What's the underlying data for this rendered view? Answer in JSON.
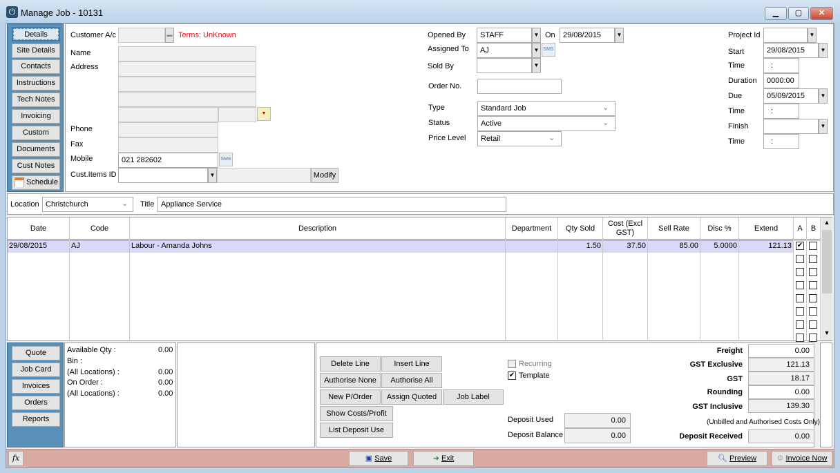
{
  "window": {
    "title": "Manage Job - 10131",
    "app_icon": "power-icon",
    "minimize": "▁",
    "maximize": "▢",
    "close": "✕"
  },
  "nav": {
    "items": [
      "Details",
      "Site Details",
      "Contacts",
      "Instructions",
      "Tech Notes",
      "Invoicing",
      "Custom Fields",
      "Documents",
      "Cust Notes",
      "Schedule"
    ]
  },
  "customer": {
    "account_label": "Customer A/c",
    "account_value": "",
    "terms": "Terms: UnKnown",
    "terms_color": "#e8101a",
    "name_label": "Name",
    "address_label": "Address",
    "phone_label": "Phone",
    "fax_label": "Fax",
    "mobile_label": "Mobile",
    "mobile_value": "021 282602",
    "cust_items_label": "Cust.Items ID",
    "cust_items_value": "",
    "modify": "Modify",
    "sms": "SMS"
  },
  "job": {
    "opened_by_label": "Opened By",
    "opened_by": "STAFF",
    "on_label": "On",
    "on_date": "29/08/2015",
    "assigned_to_label": "Assigned To",
    "assigned_to": "AJ",
    "sold_by_label": "Sold By",
    "sold_by": "",
    "order_no_label": "Order No.",
    "order_no": "",
    "type_label": "Type",
    "type": "Standard Job",
    "status_label": "Status",
    "status": "Active",
    "price_level_label": "Price Level",
    "price_level": "Retail"
  },
  "schedule": {
    "project_id_label": "Project Id",
    "project_id": "",
    "start_label": "Start",
    "start": "29/08/2015",
    "time_label": "Time",
    "start_time": ":",
    "duration_label": "Duration",
    "duration": "0000:00",
    "due_label": "Due",
    "due": "05/09/2015",
    "due_time": ":",
    "finish_label": "Finish",
    "finish": "",
    "finish_time": ":"
  },
  "location": {
    "label": "Location",
    "value": "Christchurch",
    "title_label": "Title",
    "title": "Appliance Service"
  },
  "grid": {
    "columns": [
      "Date",
      "Code",
      "Description",
      "Department",
      "Qty Sold",
      "Cost (Excl GST)",
      "Sell Rate",
      "Disc %",
      "Extend",
      "A",
      "B"
    ],
    "rows": [
      {
        "date": "29/08/2015",
        "code": "AJ",
        "description": "Labour - Amanda Johns",
        "department": "",
        "qty": "1.50",
        "cost": "37.50",
        "sell": "85.00",
        "disc": "5.0000",
        "extend": "121.13",
        "a": true,
        "b": false
      }
    ],
    "selected_row_color": "#d9d9f7"
  },
  "side_nav": {
    "items": [
      "Quote",
      "Job Card",
      "Invoices",
      "Orders",
      "Reports"
    ]
  },
  "stock": {
    "available_qty_label": "Available Qty :",
    "available_qty": "0.00",
    "bin_label": "Bin :",
    "all_locations_label": "(All Locations) :",
    "all_locations": "0.00",
    "on_order_label": "On Order :",
    "on_order": "0.00",
    "all_locations2": "0.00"
  },
  "actions": {
    "delete_line": "Delete Line",
    "insert_line": "Insert Line",
    "authorise_none": "Authorise None",
    "authorise_all": "Authorise All",
    "new_porder": "New P/Order",
    "assign_quoted": "Assign Quoted",
    "job_label": "Job Label",
    "show_costs": "Show Costs/Profit",
    "list_deposit": "List Deposit Use"
  },
  "options": {
    "recurring": "Recurring",
    "recurring_checked": false,
    "template": "Template",
    "template_checked": true
  },
  "deposit": {
    "used_label": "Deposit Used",
    "used": "0.00",
    "balance_label": "Deposit Balance",
    "balance": "0.00"
  },
  "totals": {
    "freight_label": "Freight",
    "freight": "0.00",
    "gst_excl_label": "GST Exclusive",
    "gst_excl": "121.13",
    "gst_label": "GST",
    "gst": "18.17",
    "rounding_label": "Rounding",
    "rounding": "0.00",
    "gst_incl_label": "GST Inclusive",
    "gst_incl": "139.30",
    "note": "(Unbilled and Authorised Costs Only)",
    "deposit_received_label": "Deposit Received",
    "deposit_received": "0.00"
  },
  "footer": {
    "fx": "fx",
    "save": "Save",
    "exit": "Exit",
    "preview": "Preview",
    "invoice_now": "Invoice Now"
  }
}
